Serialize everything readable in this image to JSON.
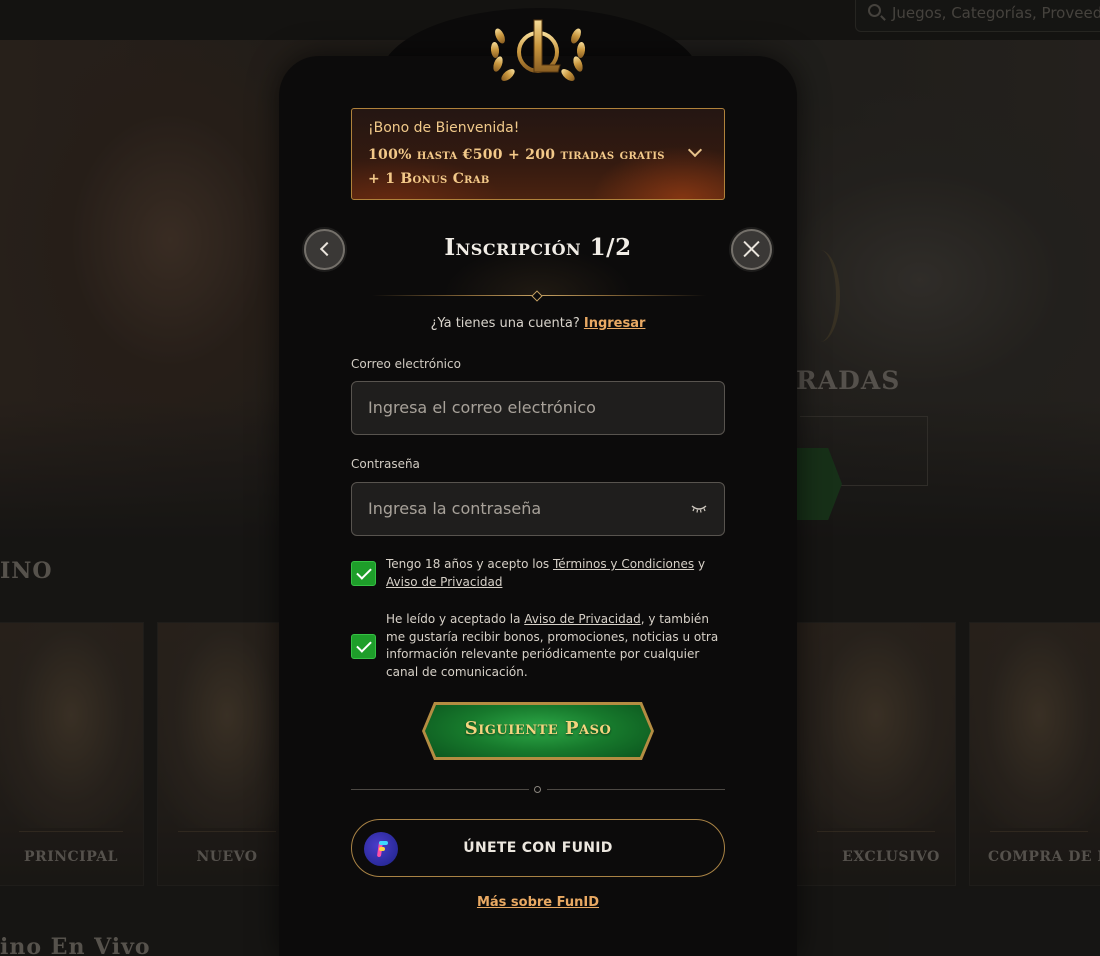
{
  "background": {
    "search_placeholder": "Juegos, Categorías, Proveedo",
    "hero_text": "RADAS",
    "section_casino": "INO",
    "section_live": "ino En Vivo",
    "cards": [
      {
        "label": "PRINCIPAL"
      },
      {
        "label": "NUEVO"
      },
      {
        "label": "EXCLUSIVO"
      },
      {
        "label": "COMPRA DE BO"
      }
    ]
  },
  "modal": {
    "logo_icon": "laurel-l-logo-icon",
    "bonus": {
      "small": "¡Bono de Bienvenida!",
      "big": "100% hasta €500 + 200 tiradas gratis + 1 Bonus Crab"
    },
    "title": "Inscripción 1/2",
    "have_account": "¿Ya tienes una cuenta?",
    "login_link": "Ingresar",
    "email": {
      "label": "Correo electrónico",
      "placeholder": "Ingresa el correo electrónico"
    },
    "password": {
      "label": "Contraseña",
      "placeholder": "Ingresa la contraseña"
    },
    "consent1": {
      "text_a": "Tengo 18 años y acepto los ",
      "link_terms": "Términos y Condiciones",
      "text_b": " y ",
      "link_privacy": "Aviso de Privacidad"
    },
    "consent2": {
      "text_a": "He leído y aceptado la ",
      "link_privacy": "Aviso de Privacidad",
      "text_b": ", y también me gustaría recibir bonos, promociones, noticias u otra información relevante periódicamente por cualquier canal de comunicación."
    },
    "next_button": "Siguiente Paso",
    "funid_button": "ÚNETE CON FUNID",
    "more_funid": "Más sobre FunID"
  },
  "colors": {
    "accent": "#e9a963",
    "gold": "#b48d42",
    "green": "#1e9e2a",
    "modal_bg": "#0c0b0b"
  }
}
